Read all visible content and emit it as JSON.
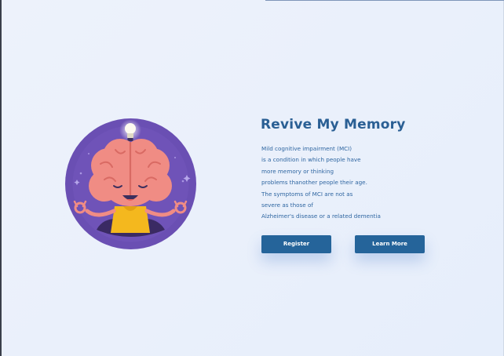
{
  "hero": {
    "title": "Revive My Memory",
    "description_lines": [
      "Mild cognitive impairment (MCI)",
      "is a condition in which people have",
      "more memory or thinking",
      "problems thanother people their age.",
      "The symptoms of MCI are not as",
      "severe as those of",
      "Alzheimer's disease or a related dementia"
    ],
    "buttons": {
      "register": "Register",
      "learn_more": "Learn More"
    },
    "illustration": {
      "icon": "meditating-brain-illustration",
      "circle_color": "#6a4fb3",
      "brain_color": "#f08c84",
      "shirt_color": "#f4b81e"
    }
  },
  "colors": {
    "accent": "#25649a",
    "title": "#2a5f94",
    "text": "#2f66a1",
    "background": "#ebf1fb"
  }
}
